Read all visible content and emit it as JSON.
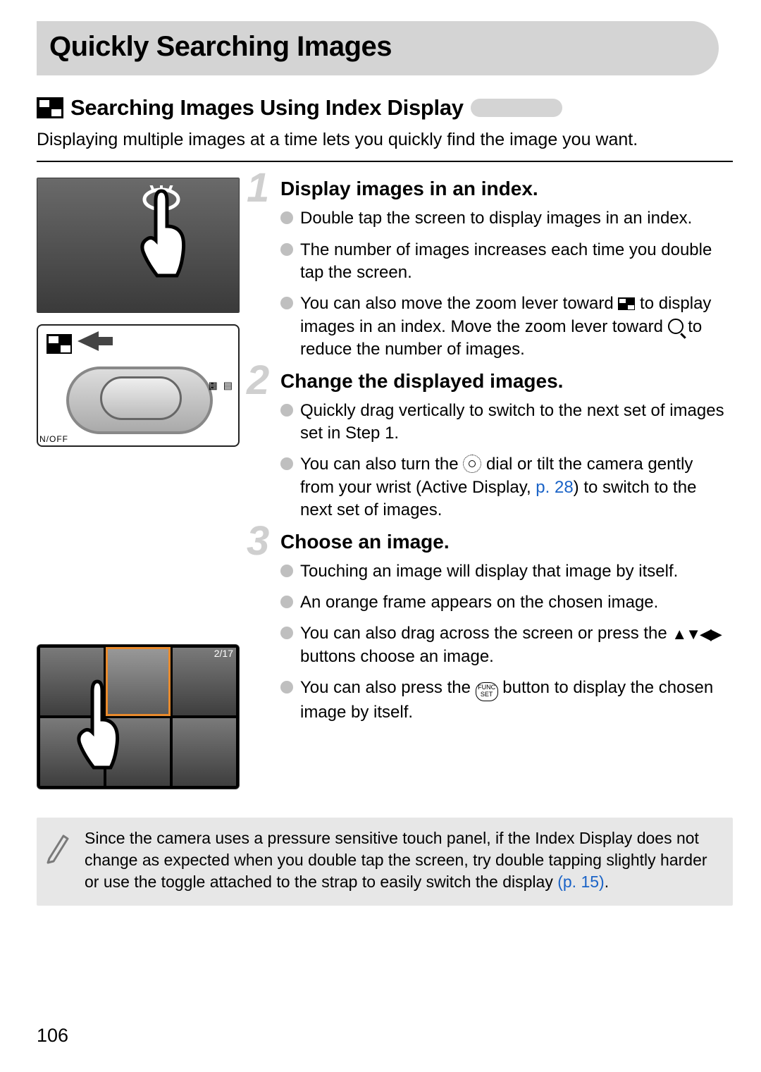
{
  "title": "Quickly Searching Images",
  "subhead": "Searching Images Using Index Display",
  "intro": "Displaying multiple images at a time lets you quickly find the image you want.",
  "diagram": {
    "onoff": "N/OFF",
    "side_icons": "▦ ▤"
  },
  "grid_shot": {
    "counter": "2/17"
  },
  "steps": [
    {
      "num": "1",
      "heading": "Display images in an index.",
      "bullets": [
        {
          "kind": "plain",
          "text": "Double tap the screen to display images in an index."
        },
        {
          "kind": "plain",
          "text": "The number of images increases each time you double tap the screen."
        },
        {
          "kind": "zoom",
          "pre": "You can also move the zoom lever toward ",
          "mid": " to display images in an index. Move the zoom lever toward ",
          "post": " to reduce the number of images."
        }
      ]
    },
    {
      "num": "2",
      "heading": "Change the displayed images.",
      "bullets": [
        {
          "kind": "plain",
          "text": "Quickly drag vertically to switch to the next set of images set in Step 1."
        },
        {
          "kind": "dial",
          "pre": "You can also turn the ",
          "mid": " dial or tilt the camera gently from your wrist (Active Display, ",
          "link": "p. 28",
          "post": ") to switch to the next set of images."
        }
      ]
    },
    {
      "num": "3",
      "heading": "Choose an image.",
      "bullets": [
        {
          "kind": "plain",
          "text": "Touching an image will display that image by itself."
        },
        {
          "kind": "plain",
          "text": "An orange frame appears on the chosen image."
        },
        {
          "kind": "arrows",
          "pre": "You can also drag across the screen or press the ",
          "post": " buttons choose an image."
        },
        {
          "kind": "func",
          "pre": "You can also press the ",
          "post": " button to display the chosen image by itself."
        }
      ]
    }
  ],
  "func_label_top": "FUNC",
  "func_label_bottom": "SET",
  "note": {
    "pre": "Since the camera uses a pressure sensitive touch panel, if the Index Display does not change as expected when you double tap the screen, try double tapping slightly harder or use the toggle attached to the strap to easily switch the display ",
    "link": "(p. 15)",
    "post": "."
  },
  "page_number": "106"
}
